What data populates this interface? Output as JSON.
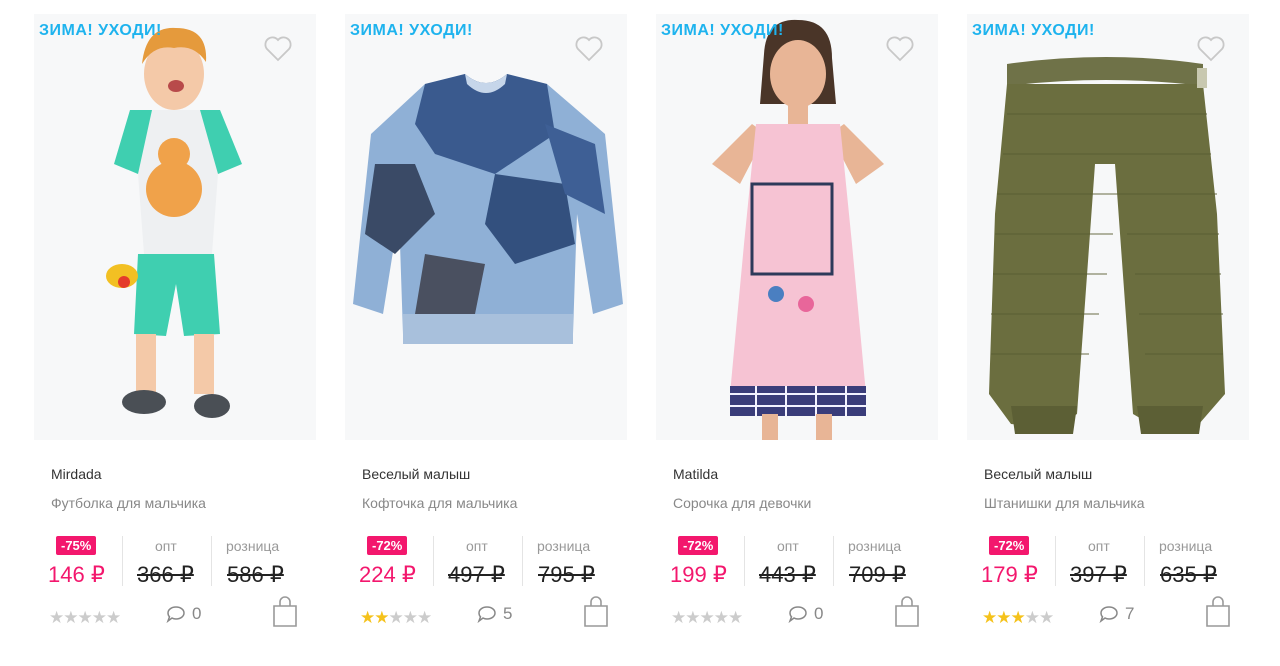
{
  "products": [
    {
      "promo": "ЗИМА! УХОДИ!",
      "brand": "Mirdada",
      "name": "Футболка для мальчика",
      "discount": "-75%",
      "price": "146 ₽",
      "opt_label": "опт",
      "opt_price": "366 ₽",
      "retail_label": "розница",
      "retail_price": "586 ₽",
      "rating": 0,
      "reviews": "0"
    },
    {
      "promo": "ЗИМА! УХОДИ!",
      "brand": "Веселый малыш",
      "name": "Кофточка для мальчика",
      "discount": "-72%",
      "price": "224 ₽",
      "opt_label": "опт",
      "opt_price": "497 ₽",
      "retail_label": "розница",
      "retail_price": "795 ₽",
      "rating": 2,
      "reviews": "5"
    },
    {
      "promo": "ЗИМА! УХОДИ!",
      "brand": "Matilda",
      "name": "Сорочка для девочки",
      "discount": "-72%",
      "price": "199 ₽",
      "opt_label": "опт",
      "opt_price": "443 ₽",
      "retail_label": "розница",
      "retail_price": "709 ₽",
      "rating": 0,
      "reviews": "0"
    },
    {
      "promo": "ЗИМА! УХОДИ!",
      "brand": "Веселый малыш",
      "name": "Штанишки для мальчика",
      "discount": "-72%",
      "price": "179 ₽",
      "opt_label": "опт",
      "opt_price": "397 ₽",
      "retail_label": "розница",
      "retail_price": "635 ₽",
      "rating": 3,
      "reviews": "7"
    }
  ],
  "colors": {
    "promo": "#1eb3ee",
    "discount": "#f3176d",
    "star_active": "#f5c21b",
    "star_inactive": "#cccccc"
  },
  "icons": {
    "favorite": "heart-outline-icon",
    "reviews": "speech-bubble-icon",
    "cart": "shopping-bag-icon",
    "rating": "star-icon"
  }
}
